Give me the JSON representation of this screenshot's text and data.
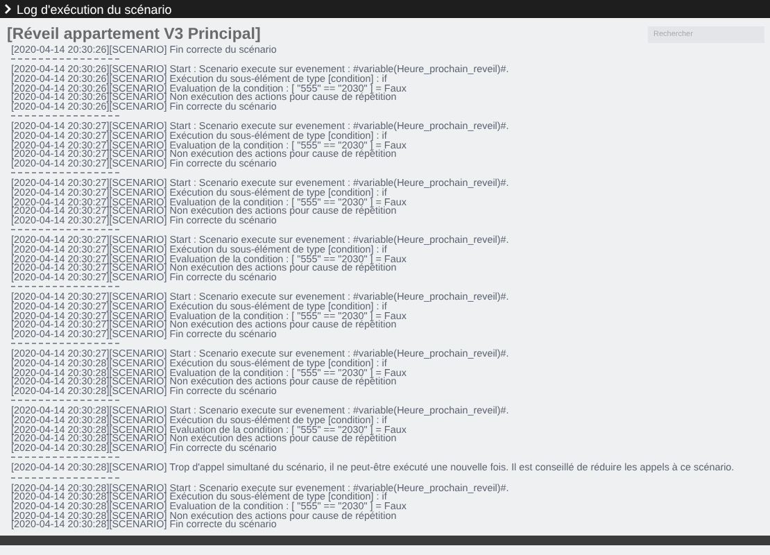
{
  "window": {
    "title": "Log d'exécution du scénario"
  },
  "scenario": {
    "title": "[Réveil appartement V3 Principal]"
  },
  "search": {
    "placeholder": "Rechercher"
  },
  "log": {
    "groups": [
      {
        "lines": [
          "[2020-04-14 20:30:26][SCENARIO] Fin correcte du scénario"
        ]
      },
      {
        "lines": [
          "[2020-04-14 20:30:26][SCENARIO] Start : Scenario execute sur evenement : #variable(Heure_prochain_reveil)#.",
          "[2020-04-14 20:30:26][SCENARIO] Exécution du sous-élément de type [condition] : if",
          "[2020-04-14 20:30:26][SCENARIO] Evaluation de la condition : [ \"555\" == \"2030\" ] = Faux",
          "[2020-04-14 20:30:26][SCENARIO] Non exécution des actions pour cause de répétition",
          "[2020-04-14 20:30:26][SCENARIO] Fin correcte du scénario"
        ]
      },
      {
        "lines": [
          "[2020-04-14 20:30:27][SCENARIO] Start : Scenario execute sur evenement : #variable(Heure_prochain_reveil)#.",
          "[2020-04-14 20:30:27][SCENARIO] Exécution du sous-élément de type [condition] : if",
          "[2020-04-14 20:30:27][SCENARIO] Evaluation de la condition : [ \"555\" == \"2030\" ] = Faux",
          "[2020-04-14 20:30:27][SCENARIO] Non exécution des actions pour cause de répétition",
          "[2020-04-14 20:30:27][SCENARIO] Fin correcte du scénario"
        ]
      },
      {
        "lines": [
          "[2020-04-14 20:30:27][SCENARIO] Start : Scenario execute sur evenement : #variable(Heure_prochain_reveil)#.",
          "[2020-04-14 20:30:27][SCENARIO] Exécution du sous-élément de type [condition] : if",
          "[2020-04-14 20:30:27][SCENARIO] Evaluation de la condition : [ \"555\" == \"2030\" ] = Faux",
          "[2020-04-14 20:30:27][SCENARIO] Non exécution des actions pour cause de répétition",
          "[2020-04-14 20:30:27][SCENARIO] Fin correcte du scénario"
        ]
      },
      {
        "lines": [
          "[2020-04-14 20:30:27][SCENARIO] Start : Scenario execute sur evenement : #variable(Heure_prochain_reveil)#.",
          "[2020-04-14 20:30:27][SCENARIO] Exécution du sous-élément de type [condition] : if",
          "[2020-04-14 20:30:27][SCENARIO] Evaluation de la condition : [ \"555\" == \"2030\" ] = Faux",
          "[2020-04-14 20:30:27][SCENARIO] Non exécution des actions pour cause de répétition",
          "[2020-04-14 20:30:27][SCENARIO] Fin correcte du scénario"
        ]
      },
      {
        "lines": [
          "[2020-04-14 20:30:27][SCENARIO] Start : Scenario execute sur evenement : #variable(Heure_prochain_reveil)#.",
          "[2020-04-14 20:30:27][SCENARIO] Exécution du sous-élément de type [condition] : if",
          "[2020-04-14 20:30:27][SCENARIO] Evaluation de la condition : [ \"555\" == \"2030\" ] = Faux",
          "[2020-04-14 20:30:27][SCENARIO] Non exécution des actions pour cause de répétition",
          "[2020-04-14 20:30:27][SCENARIO] Fin correcte du scénario"
        ]
      },
      {
        "lines": [
          "[2020-04-14 20:30:27][SCENARIO] Start : Scenario execute sur evenement : #variable(Heure_prochain_reveil)#.",
          "[2020-04-14 20:30:28][SCENARIO] Exécution du sous-élément de type [condition] : if",
          "[2020-04-14 20:30:28][SCENARIO] Evaluation de la condition : [ \"555\" == \"2030\" ] = Faux",
          "[2020-04-14 20:30:28][SCENARIO] Non exécution des actions pour cause de répétition",
          "[2020-04-14 20:30:28][SCENARIO] Fin correcte du scénario"
        ]
      },
      {
        "lines": [
          "[2020-04-14 20:30:28][SCENARIO] Start : Scenario execute sur evenement : #variable(Heure_prochain_reveil)#.",
          "[2020-04-14 20:30:28][SCENARIO] Exécution du sous-élément de type [condition] : if",
          "[2020-04-14 20:30:28][SCENARIO] Evaluation de la condition : [ \"555\" == \"2030\" ] = Faux",
          "[2020-04-14 20:30:28][SCENARIO] Non exécution des actions pour cause de répétition",
          "[2020-04-14 20:30:28][SCENARIO] Fin correcte du scénario"
        ]
      },
      {
        "lines": [
          "[2020-04-14 20:30:28][SCENARIO] Trop d'appel simultané du scénario, il ne peut-être exécuté une nouvelle fois. Il est conseillé de réduire les appels à ce scénario."
        ]
      },
      {
        "lines": [
          "[2020-04-14 20:30:28][SCENARIO] Start : Scenario execute sur evenement : #variable(Heure_prochain_reveil)#.",
          "[2020-04-14 20:30:28][SCENARIO] Exécution du sous-élément de type [condition] : if",
          "[2020-04-14 20:30:28][SCENARIO] Evaluation de la condition : [ \"555\" == \"2030\" ] = Faux",
          "[2020-04-14 20:30:28][SCENARIO] Non exécution des actions pour cause de répétition",
          "[2020-04-14 20:30:28][SCENARIO] Fin correcte du scénario"
        ]
      }
    ]
  }
}
